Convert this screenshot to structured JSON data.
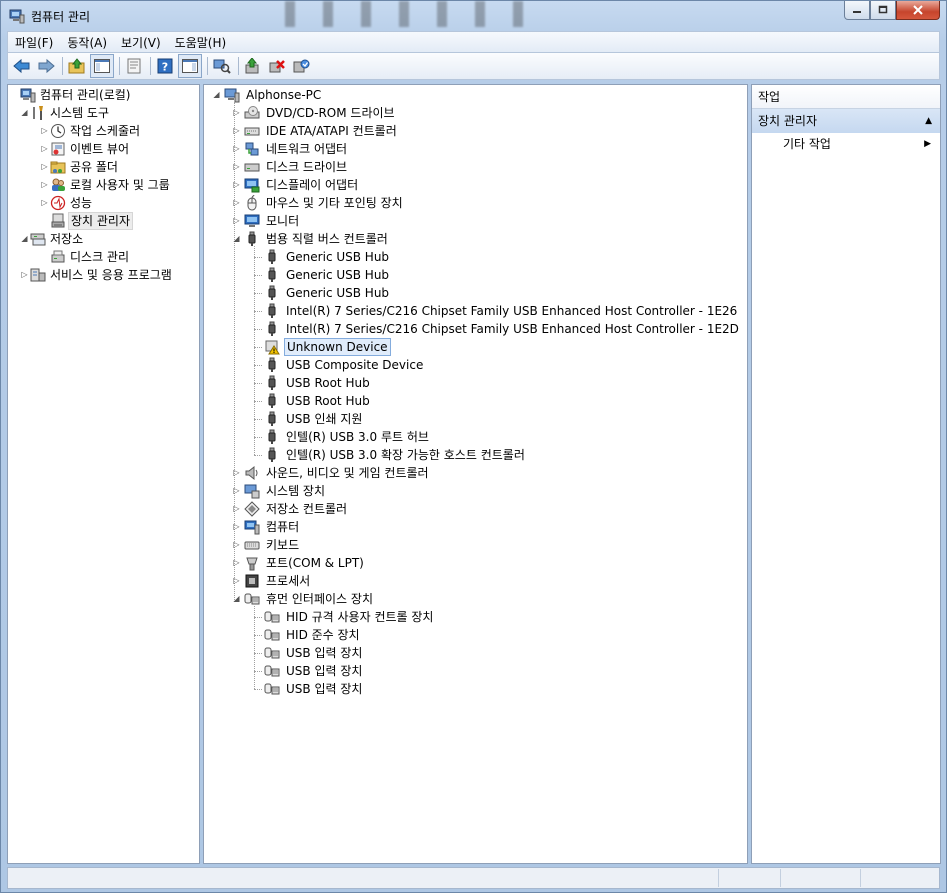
{
  "window": {
    "title": "컴퓨터 관리"
  },
  "menubar": [
    "파일(F)",
    "동작(A)",
    "보기(V)",
    "도움말(H)"
  ],
  "left_tree": [
    {
      "label": "컴퓨터 관리(로컬)",
      "icon": "computer-management-icon",
      "level": 0,
      "expander": "none"
    },
    {
      "label": "시스템 도구",
      "icon": "tools-icon",
      "level": 1,
      "expander": "expanded"
    },
    {
      "label": "작업 스케줄러",
      "icon": "clock-icon",
      "level": 2,
      "expander": "collapsed"
    },
    {
      "label": "이벤트 뷰어",
      "icon": "event-viewer-icon",
      "level": 2,
      "expander": "collapsed"
    },
    {
      "label": "공유 폴더",
      "icon": "shared-folder-icon",
      "level": 2,
      "expander": "collapsed"
    },
    {
      "label": "로컬 사용자 및 그룹",
      "icon": "users-icon",
      "level": 2,
      "expander": "collapsed"
    },
    {
      "label": "성능",
      "icon": "performance-icon",
      "level": 2,
      "expander": "collapsed"
    },
    {
      "label": "장치 관리자",
      "icon": "device-manager-icon",
      "level": 2,
      "expander": "none",
      "selected": true
    },
    {
      "label": "저장소",
      "icon": "storage-icon",
      "level": 1,
      "expander": "expanded"
    },
    {
      "label": "디스크 관리",
      "icon": "disk-management-icon",
      "level": 2,
      "expander": "none"
    },
    {
      "label": "서비스 및 응용 프로그램",
      "icon": "services-icon",
      "level": 1,
      "expander": "collapsed"
    }
  ],
  "device_tree": {
    "root": "Alphonse-PC",
    "items": [
      {
        "label": "DVD/CD-ROM 드라이브",
        "icon": "dvd-drive-icon",
        "level": 1,
        "expander": "collapsed"
      },
      {
        "label": "IDE ATA/ATAPI 컨트롤러",
        "icon": "ide-controller-icon",
        "level": 1,
        "expander": "collapsed"
      },
      {
        "label": "네트워크 어댑터",
        "icon": "network-adapter-icon",
        "level": 1,
        "expander": "collapsed"
      },
      {
        "label": "디스크 드라이브",
        "icon": "disk-drive-icon",
        "level": 1,
        "expander": "collapsed"
      },
      {
        "label": "디스플레이 어댑터",
        "icon": "display-adapter-icon",
        "level": 1,
        "expander": "collapsed"
      },
      {
        "label": "마우스 및 기타 포인팅 장치",
        "icon": "mouse-icon",
        "level": 1,
        "expander": "collapsed"
      },
      {
        "label": "모니터",
        "icon": "monitor-icon",
        "level": 1,
        "expander": "collapsed"
      },
      {
        "label": "범용 직렬 버스 컨트롤러",
        "icon": "usb-icon",
        "level": 1,
        "expander": "expanded"
      },
      {
        "label": "Generic USB Hub",
        "icon": "usb-icon",
        "level": 2,
        "expander": "none"
      },
      {
        "label": "Generic USB Hub",
        "icon": "usb-icon",
        "level": 2,
        "expander": "none"
      },
      {
        "label": "Generic USB Hub",
        "icon": "usb-icon",
        "level": 2,
        "expander": "none"
      },
      {
        "label": "Intel(R) 7 Series/C216 Chipset Family USB Enhanced Host Controller - 1E26",
        "icon": "usb-icon",
        "level": 2,
        "expander": "none"
      },
      {
        "label": "Intel(R) 7 Series/C216 Chipset Family USB Enhanced Host Controller - 1E2D",
        "icon": "usb-icon",
        "level": 2,
        "expander": "none"
      },
      {
        "label": "Unknown Device",
        "icon": "unknown-device-warning-icon",
        "level": 2,
        "expander": "none",
        "selected": true
      },
      {
        "label": "USB Composite Device",
        "icon": "usb-icon",
        "level": 2,
        "expander": "none"
      },
      {
        "label": "USB Root Hub",
        "icon": "usb-icon",
        "level": 2,
        "expander": "none"
      },
      {
        "label": "USB Root Hub",
        "icon": "usb-icon",
        "level": 2,
        "expander": "none"
      },
      {
        "label": "USB 인쇄 지원",
        "icon": "usb-icon",
        "level": 2,
        "expander": "none"
      },
      {
        "label": "인텔(R) USB 3.0 루트 허브",
        "icon": "usb-icon",
        "level": 2,
        "expander": "none"
      },
      {
        "label": "인텔(R) USB 3.0 확장 가능한 호스트 컨트롤러",
        "icon": "usb-icon",
        "level": 2,
        "expander": "none"
      },
      {
        "label": "사운드, 비디오 및 게임 컨트롤러",
        "icon": "speaker-icon",
        "level": 1,
        "expander": "collapsed"
      },
      {
        "label": "시스템 장치",
        "icon": "system-device-icon",
        "level": 1,
        "expander": "collapsed"
      },
      {
        "label": "저장소 컨트롤러",
        "icon": "storage-controller-icon",
        "level": 1,
        "expander": "collapsed"
      },
      {
        "label": "컴퓨터",
        "icon": "computer-icon",
        "level": 1,
        "expander": "collapsed"
      },
      {
        "label": "키보드",
        "icon": "keyboard-icon",
        "level": 1,
        "expander": "collapsed"
      },
      {
        "label": "포트(COM & LPT)",
        "icon": "port-icon",
        "level": 1,
        "expander": "collapsed"
      },
      {
        "label": "프로세서",
        "icon": "processor-icon",
        "level": 1,
        "expander": "collapsed"
      },
      {
        "label": "휴먼 인터페이스 장치",
        "icon": "hid-icon",
        "level": 1,
        "expander": "expanded"
      },
      {
        "label": "HID 규격 사용자 컨트롤 장치",
        "icon": "hid-icon",
        "level": 2,
        "expander": "none"
      },
      {
        "label": "HID 준수 장치",
        "icon": "hid-icon",
        "level": 2,
        "expander": "none"
      },
      {
        "label": "USB 입력 장치",
        "icon": "hid-icon",
        "level": 2,
        "expander": "none"
      },
      {
        "label": "USB 입력 장치",
        "icon": "hid-icon",
        "level": 2,
        "expander": "none"
      },
      {
        "label": "USB 입력 장치",
        "icon": "hid-icon",
        "level": 2,
        "expander": "none"
      }
    ]
  },
  "actions": {
    "title": "작업",
    "section": "장치 관리자",
    "item": "기타 작업"
  },
  "colors": {
    "selection_blue": "#e0ecfb",
    "warning_yellow": "#f5c400"
  }
}
